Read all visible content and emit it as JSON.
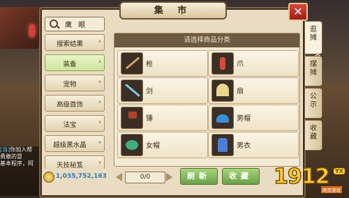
{
  "window": {
    "title": "集 市"
  },
  "search": {
    "label": "鹰 眼"
  },
  "categories": [
    {
      "label": "搜索结果"
    },
    {
      "label": "装备"
    },
    {
      "label": "宠物"
    },
    {
      "label": "高级首饰"
    },
    {
      "label": "法宝"
    },
    {
      "label": "超级黑水晶"
    },
    {
      "label": "天技秘笈"
    }
  ],
  "active_category": "装备",
  "grid": {
    "heading": "请选择商品分类",
    "items": [
      {
        "label": "枪",
        "icon": "spear-icon"
      },
      {
        "label": "爪",
        "icon": "claw-icon"
      },
      {
        "label": "剑",
        "icon": "sword-icon"
      },
      {
        "label": "扇",
        "icon": "fan-icon"
      },
      {
        "label": "锤",
        "icon": "hammer-icon"
      },
      {
        "label": "男帽",
        "icon": "male-hat-icon"
      },
      {
        "label": "女帽",
        "icon": "female-hat-icon"
      },
      {
        "label": "男衣",
        "icon": "male-robe-icon"
      }
    ]
  },
  "gold": {
    "amount": "1,035,752,163"
  },
  "stepper": {
    "value": "0/0"
  },
  "buttons": {
    "refresh": "刷新",
    "favorite": "收藏"
  },
  "side_tabs": [
    {
      "label": "逛摊",
      "active": true
    },
    {
      "label": "摆摊",
      "active": false
    },
    {
      "label": "公示",
      "active": false
    },
    {
      "label": "收藏",
      "active": false
    }
  ],
  "chat": {
    "line1_tag": "[当]",
    "line1": "你加入帮",
    "line2": "勇敢的冒",
    "line3": "基本程序，阿"
  },
  "watermark": {
    "number": "1912",
    "badge": "YX",
    "site": "网页游戏"
  },
  "colors": {
    "accent_green": "#8dbd5f",
    "panel_bg": "#e9dcc2",
    "close_red": "#c23a30"
  }
}
